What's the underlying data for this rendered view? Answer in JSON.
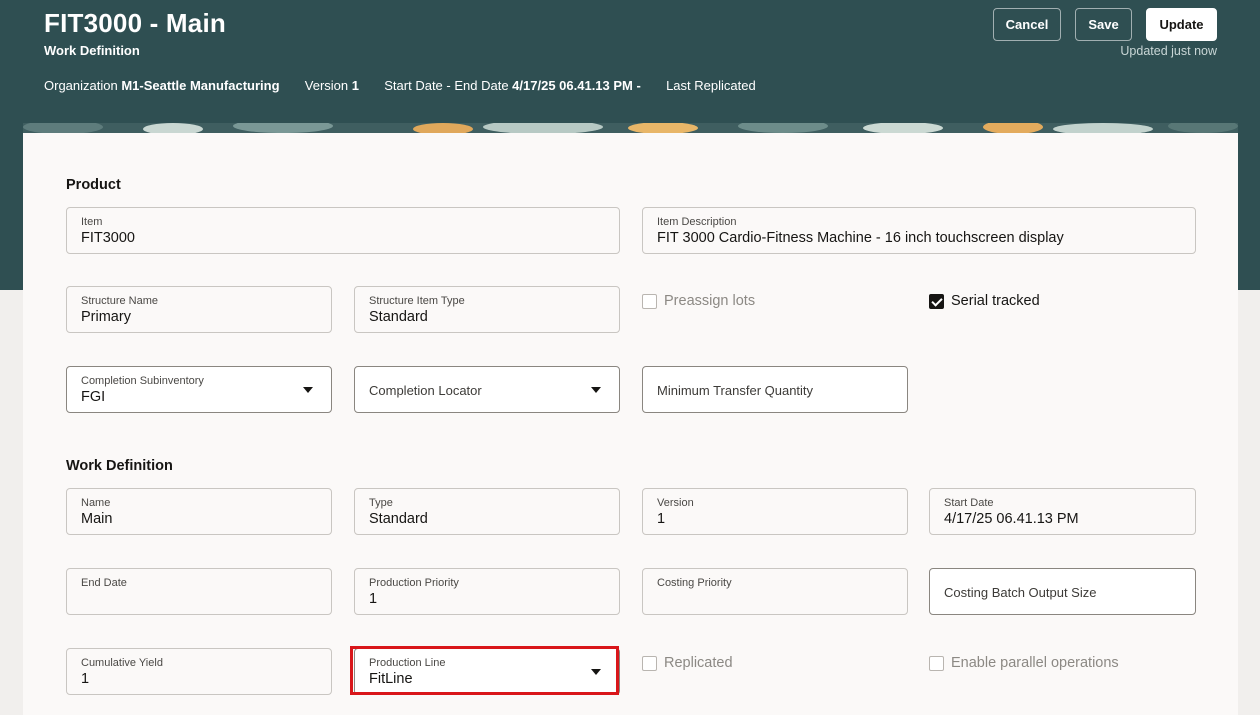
{
  "header": {
    "title": "FIT3000 - Main",
    "subtitle": "Work Definition",
    "meta": {
      "org_label": "Organization",
      "org_value": "M1-Seattle Manufacturing",
      "version_label": "Version",
      "version_value": "1",
      "dates_label": "Start Date - End Date",
      "dates_value": "4/17/25 06.41.13 PM -",
      "replicated_label": "Last Replicated"
    },
    "buttons": {
      "cancel": "Cancel",
      "save": "Save",
      "update": "Update"
    },
    "status": "Updated just now"
  },
  "product": {
    "section_title": "Product",
    "item": {
      "label": "Item",
      "value": "FIT3000"
    },
    "item_description": {
      "label": "Item Description",
      "value": "FIT 3000 Cardio-Fitness Machine - 16 inch touchscreen display"
    },
    "structure_name": {
      "label": "Structure Name",
      "value": "Primary"
    },
    "structure_item_type": {
      "label": "Structure Item Type",
      "value": "Standard"
    },
    "preassign_lots": {
      "label": "Preassign lots",
      "checked": false
    },
    "serial_tracked": {
      "label": "Serial tracked",
      "checked": true
    },
    "completion_subinventory": {
      "label": "Completion Subinventory",
      "value": "FGI"
    },
    "completion_locator": {
      "label": "Completion Locator"
    },
    "minimum_transfer_quantity": {
      "label": "Minimum Transfer Quantity"
    }
  },
  "work_definition": {
    "section_title": "Work Definition",
    "name": {
      "label": "Name",
      "value": "Main"
    },
    "type": {
      "label": "Type",
      "value": "Standard"
    },
    "version": {
      "label": "Version",
      "value": "1"
    },
    "start_date": {
      "label": "Start Date",
      "value": "4/17/25 06.41.13 PM"
    },
    "end_date": {
      "label": "End Date",
      "value": ""
    },
    "production_priority": {
      "label": "Production Priority",
      "value": "1"
    },
    "costing_priority": {
      "label": "Costing Priority",
      "value": ""
    },
    "costing_batch_output_size": {
      "label": "Costing Batch Output Size"
    },
    "cumulative_yield": {
      "label": "Cumulative Yield",
      "value": "1"
    },
    "production_line": {
      "label": "Production Line",
      "value": "FitLine"
    },
    "replicated": {
      "label": "Replicated",
      "checked": false
    },
    "enable_parallel_operations": {
      "label": "Enable parallel operations",
      "checked": false
    }
  },
  "colors": {
    "header_bg": "#2f4f52",
    "highlight": "#d9161a"
  }
}
